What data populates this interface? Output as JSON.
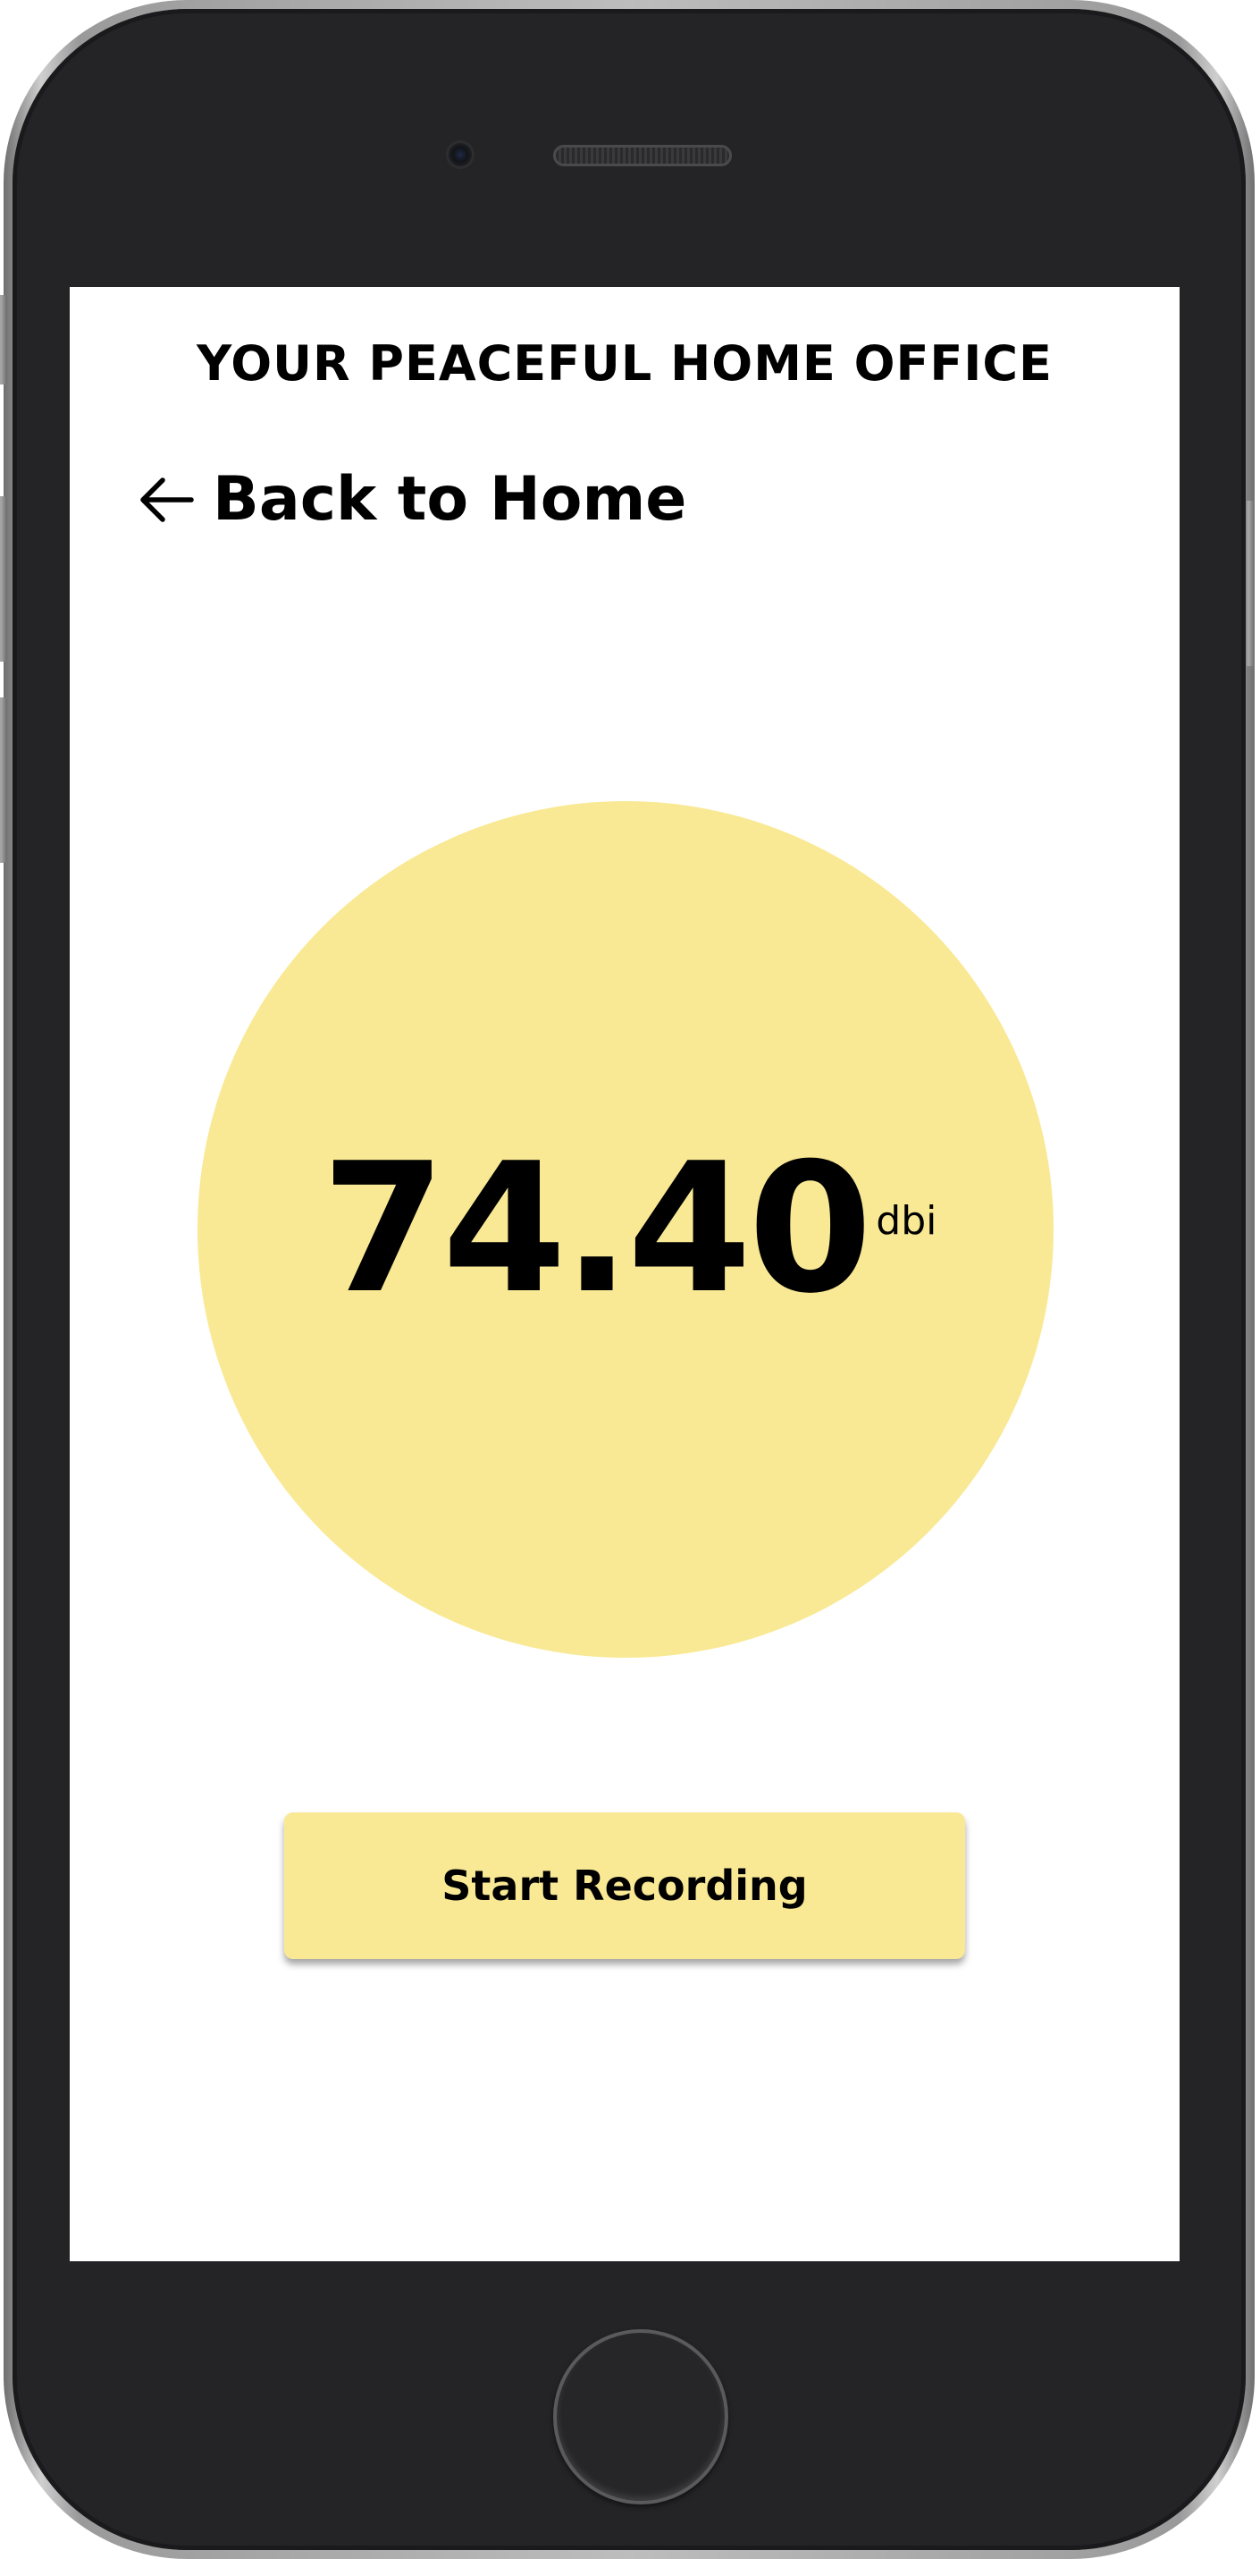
{
  "header": {
    "title": "YOUR PEACEFUL HOME OFFICE"
  },
  "nav": {
    "back_label": "Back to Home",
    "back_icon": "arrow-left-icon"
  },
  "reading": {
    "value": "74.40",
    "unit": "dbi",
    "circle_color": "#f9e994"
  },
  "actions": {
    "record_label": "Start Recording",
    "button_color": "#f9e994"
  }
}
